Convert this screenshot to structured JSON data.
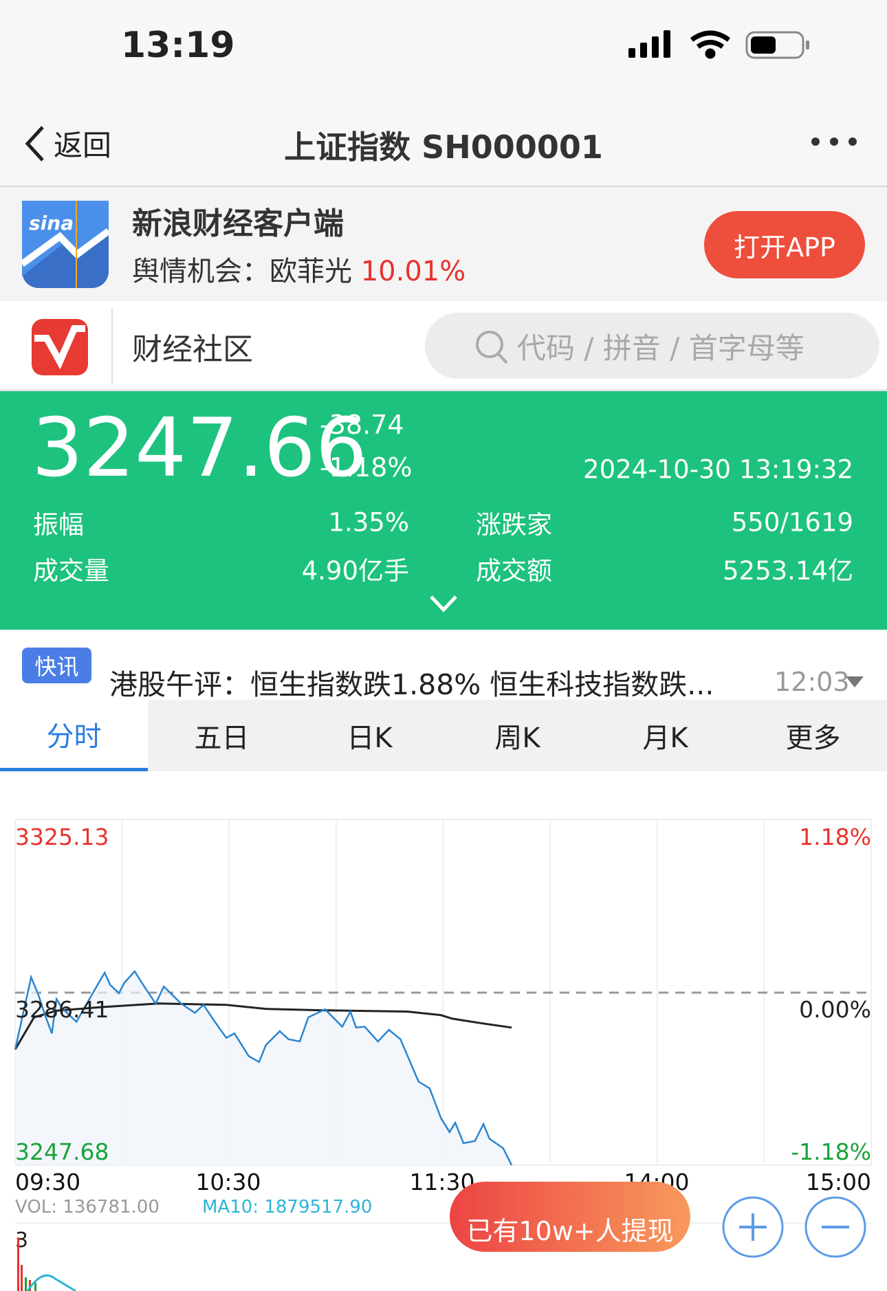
{
  "status_bar": {
    "time": "13:19",
    "icons": [
      "signal-icon",
      "wifi-icon",
      "battery-icon"
    ]
  },
  "nav": {
    "back_label": "返回",
    "title": "上证指数 SH000001",
    "more_icon": "ellipsis-icon"
  },
  "ad": {
    "app_name": "新浪财经客户端",
    "subtitle_prefix": "舆情机会：欧菲光",
    "subtitle_value": "10.01%",
    "open_button": "打开APP",
    "value_color": "#e8322e"
  },
  "community": {
    "label": "财经社区",
    "search_placeholder": "代码 / 拼音 / 首字母等"
  },
  "quote": {
    "price": "3247.66",
    "change": "-38.74",
    "change_pct": "-1.18%",
    "datetime": "2024-10-30 13:19:32",
    "stats": [
      {
        "label": "振幅",
        "value": "1.35%"
      },
      {
        "label": "涨跌家",
        "value": "550/1619"
      },
      {
        "label": "成交量",
        "value": "4.90亿手"
      },
      {
        "label": "成交额",
        "value": "5253.14亿"
      }
    ],
    "bg_color": "#1dc27e"
  },
  "news": {
    "badge": "快讯",
    "headline": "港股午评：恒生指数跌1.88% 恒生科技指数跌...",
    "time": "12:03"
  },
  "tabs": [
    {
      "label": "分时",
      "active": true
    },
    {
      "label": "五日"
    },
    {
      "label": "日K"
    },
    {
      "label": "周K"
    },
    {
      "label": "月K"
    },
    {
      "label": "更多"
    }
  ],
  "chart_data": {
    "type": "line",
    "y_labels_left": {
      "top": "3325.13",
      "mid": "3286.41",
      "bottom": "3247.68"
    },
    "y_labels_right": {
      "top": "1.18%",
      "mid": "0.00%",
      "bottom": "-1.18%"
    },
    "x_labels": [
      "09:30",
      "10:30",
      "11:30",
      "14:00",
      "15:00"
    ],
    "ylim": [
      3247.68,
      3325.13
    ],
    "prev_close": 3286.41,
    "x_unit": "trading minutes from 09:30",
    "xlim": [
      0,
      240
    ],
    "price": {
      "x": [
        0,
        4.5,
        6.5,
        8.4,
        10.3,
        11.6,
        13.2,
        17.2,
        21.9,
        25.1,
        26.7,
        29.1,
        30.6,
        33.5,
        36.2,
        39.4,
        41.7,
        46.5,
        50.4,
        52.8,
        56,
        59.2,
        61.5,
        65.5,
        68.4,
        70.3,
        74.2,
        76.6,
        79.8,
        82.2,
        86.9,
        91.7,
        94,
        95.6,
        98,
        101.7,
        104.8,
        108,
        113.1,
        116.2,
        119.4,
        121.8,
        123.4,
        125.7,
        128.9,
        131.3,
        133,
        136.8,
        139.2
      ],
      "y": [
        3273.6,
        3289.8,
        3285.9,
        3281.3,
        3277.2,
        3284.9,
        3282.8,
        3279.8,
        3286.4,
        3290.8,
        3288.0,
        3286.2,
        3288.5,
        3291.1,
        3287.7,
        3283.9,
        3287.7,
        3283.9,
        3281.8,
        3283.6,
        3279.8,
        3276.2,
        3277.2,
        3272.1,
        3270.8,
        3274.6,
        3277.7,
        3275.9,
        3275.4,
        3280.8,
        3282.6,
        3278.7,
        3282.1,
        3278.5,
        3278.7,
        3275.4,
        3278.0,
        3275.9,
        3266.4,
        3264.9,
        3258.2,
        3255.1,
        3257.2,
        3252.6,
        3253.1,
        3256.9,
        3253.6,
        3251.5,
        3247.7
      ],
      "color": "#2a85d0"
    },
    "average": {
      "x": [
        0,
        5.3,
        11.6,
        24.3,
        40.2,
        59.2,
        70.3,
        84.5,
        109.9,
        119.4,
        122.6,
        130.5,
        139.2
      ],
      "y": [
        3273.6,
        3280.8,
        3282.3,
        3283.1,
        3283.9,
        3283.6,
        3282.7,
        3282.4,
        3282.1,
        3281.3,
        3280.5,
        3279.5,
        3278.5
      ],
      "color": "#222222"
    },
    "volume": {
      "vol_label": "VOL: 136781.00",
      "ma10_label": "MA10: 1879517.90",
      "axis_label": "3"
    }
  },
  "promo": {
    "label": "已有10w+人提现"
  },
  "zoom": {
    "in_icon": "zoom-in-icon",
    "out_icon": "zoom-out-icon"
  }
}
